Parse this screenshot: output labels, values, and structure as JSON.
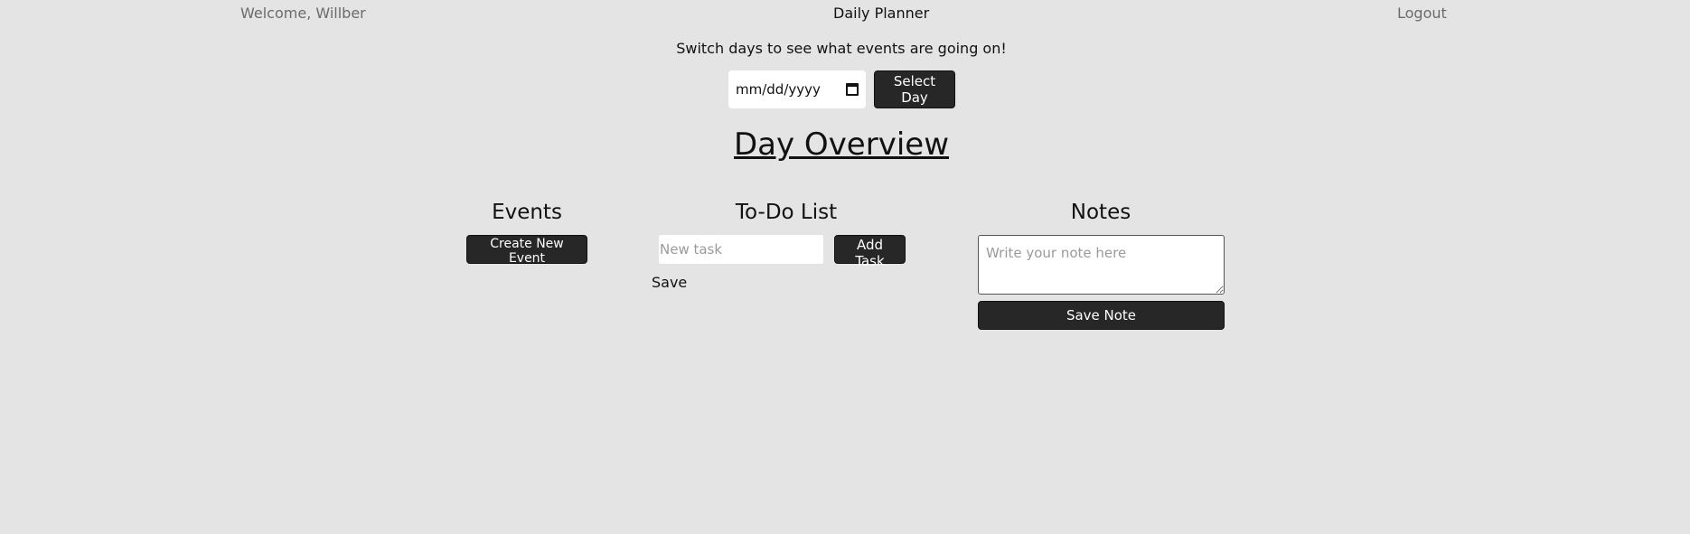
{
  "nav": {
    "welcome": "Welcome, Willber",
    "title": "Daily Planner",
    "logout": "Logout"
  },
  "day_picker": {
    "intro": "Switch days to see what events are going on!",
    "date_placeholder": "mm/dd/yyyy",
    "select_label": "Select Day"
  },
  "overview": {
    "heading": "Day Overview"
  },
  "events": {
    "title": "Events",
    "create_label": "Create New Event"
  },
  "todo": {
    "title": "To-Do List",
    "task_placeholder": "New task",
    "add_label": "Add Task",
    "save_label": "Save"
  },
  "notes": {
    "title": "Notes",
    "note_placeholder": "Write your note here",
    "save_label": "Save Note"
  },
  "colors": {
    "background": "#e4e4e4",
    "button": "#272727"
  }
}
